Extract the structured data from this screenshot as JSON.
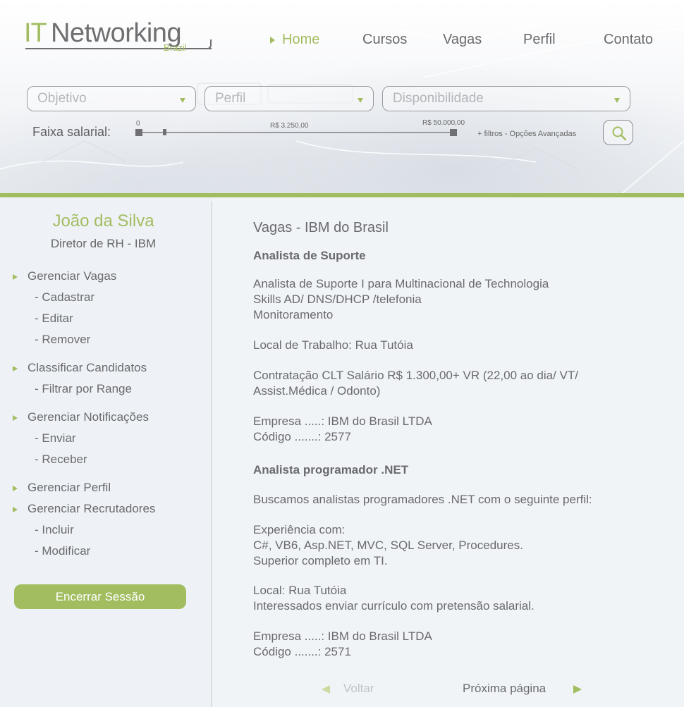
{
  "logo": {
    "primary": "IT",
    "secondary": "Networking",
    "tagline": "Brazil"
  },
  "nav": {
    "items": [
      {
        "label": "Home",
        "active": true
      },
      {
        "label": "Cursos"
      },
      {
        "label": "Vagas"
      },
      {
        "label": "Perfil"
      },
      {
        "label": "Contato"
      }
    ]
  },
  "filters": {
    "selects": [
      {
        "label": "Objetivo"
      },
      {
        "label": "Perfil"
      },
      {
        "label": "Disponibilidade"
      }
    ],
    "salary": {
      "label": "Faixa salarial:",
      "min_label": "0",
      "mid_label": "R$ 3.250,00",
      "max_label": "R$ 50.000,00"
    },
    "advanced_link": "+ filtros - Opções Avançadas",
    "search_icon": "search-icon"
  },
  "user": {
    "name": "João da Silva",
    "role": "Diretor de RH - IBM"
  },
  "menu": [
    {
      "label": "Gerenciar Vagas",
      "subitems": [
        "- Cadastrar",
        "- Editar",
        "- Remover"
      ]
    },
    {
      "label": "Classificar Candidatos",
      "subitems": [
        "- Filtrar por Range"
      ]
    },
    {
      "label": "Gerenciar Notificações",
      "subitems": [
        "- Enviar",
        "- Receber"
      ]
    },
    {
      "label": "Gerenciar Perfil",
      "subitems": []
    },
    {
      "label": "Gerenciar Recrutadores",
      "subitems": [
        "- Incluir",
        "- Modificar"
      ]
    }
  ],
  "logout_label": "Encerrar Sessão",
  "main": {
    "title": "Vagas - IBM do Brasil",
    "jobs": [
      {
        "title": "Analista de Suporte",
        "desc1": "Analista de Suporte I para Multinacional de Technologia",
        "desc2": "Skills AD/ DNS/DHCP /telefonia",
        "desc3": "Monitoramento",
        "local": "Local de Trabalho: Rua Tutóia",
        "contract1": "Contratação CLT Salário R$ 1.300,00+ VR (22,00 ao dia/ VT/",
        "contract2": "Assist.Médica / Odonto)",
        "company": "Empresa .....: IBM do Brasil LTDA",
        "code": "Código .......: 2577"
      },
      {
        "title": "Analista programador .NET",
        "intro": "Buscamos analistas programadores .NET com o seguinte perfil:",
        "exp1": "Experiência com:",
        "exp2": "C#, VB6, Asp.NET, MVC, SQL Server, Procedures.",
        "exp3": "Superior completo em TI.",
        "local": "Local: Rua Tutóia",
        "note": "Interessados enviar currículo com pretensão salarial.",
        "company": "Empresa .....: IBM do Brasil LTDA",
        "code": "Código .......: 2571"
      }
    ]
  },
  "pager": {
    "prev": "Voltar",
    "next": "Próxima página"
  },
  "colors": {
    "accent": "#a2bd5f",
    "text": "#6a6a6e",
    "muted": "#b4b6ba"
  }
}
